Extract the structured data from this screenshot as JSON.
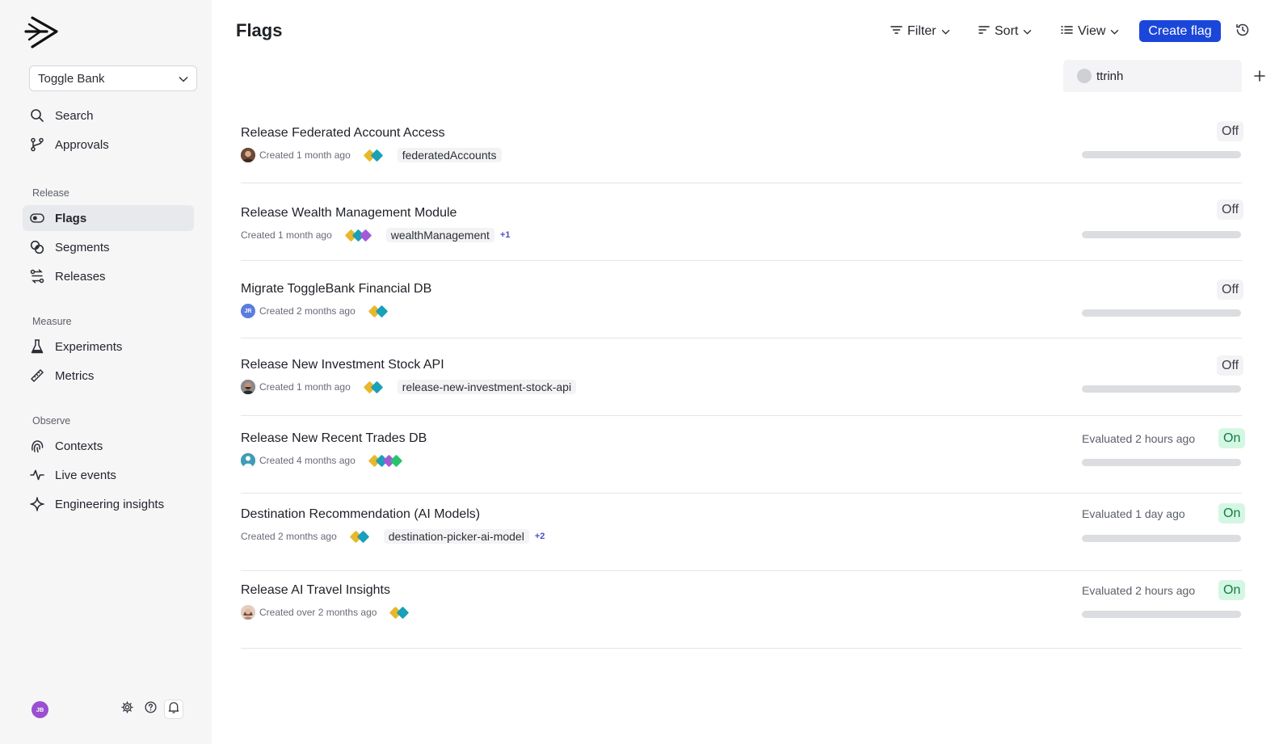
{
  "sidebar": {
    "project": "Toggle Bank",
    "top_items": [
      {
        "label": "Search",
        "icon": "search-icon"
      },
      {
        "label": "Approvals",
        "icon": "branch-icon"
      }
    ],
    "sections": [
      {
        "label": "Release",
        "items": [
          {
            "label": "Flags",
            "icon": "toggle-icon",
            "active": true
          },
          {
            "label": "Segments",
            "icon": "segments-icon"
          },
          {
            "label": "Releases",
            "icon": "releases-icon"
          }
        ]
      },
      {
        "label": "Measure",
        "items": [
          {
            "label": "Experiments",
            "icon": "flask-icon"
          },
          {
            "label": "Metrics",
            "icon": "ruler-icon"
          }
        ]
      },
      {
        "label": "Observe",
        "items": [
          {
            "label": "Contexts",
            "icon": "fingerprint-icon"
          },
          {
            "label": "Live events",
            "icon": "pulse-icon"
          },
          {
            "label": "Engineering insights",
            "icon": "sparkle-icon"
          }
        ]
      }
    ],
    "user_initials": "JB"
  },
  "header": {
    "title": "Flags",
    "filter_label": "Filter",
    "sort_label": "Sort",
    "view_label": "View",
    "create_label": "Create flag"
  },
  "environment": {
    "name": "ttrinh"
  },
  "flags": [
    {
      "name": "Release Federated Account Access",
      "created": "Created 1 month ago",
      "key": "federatedAccounts",
      "key_more": "",
      "evaluated": "",
      "status": "Off"
    },
    {
      "name": "Release Wealth Management Module",
      "created": "Created 1 month ago",
      "key": "wealthManagement",
      "key_more": "+1",
      "evaluated": "",
      "status": "Off"
    },
    {
      "name": "Migrate ToggleBank Financial DB",
      "created": "Created 2 months ago",
      "key": "",
      "key_more": "",
      "evaluated": "",
      "status": "Off",
      "avatar_initials": "JR"
    },
    {
      "name": "Release New Investment Stock API",
      "created": "Created 1 month ago",
      "key": "release-new-investment-stock-api",
      "key_more": "",
      "evaluated": "",
      "status": "Off"
    },
    {
      "name": "Release New Recent Trades DB",
      "created": "Created 4 months ago",
      "key": "",
      "key_more": "",
      "evaluated": "Evaluated 2 hours ago",
      "status": "On"
    },
    {
      "name": "Destination Recommendation (AI Models)",
      "created": "Created 2 months ago",
      "key": "destination-picker-ai-model",
      "key_more": "+2",
      "evaluated": "Evaluated 1 day ago",
      "status": "On"
    },
    {
      "name": "Release AI Travel Insights",
      "created": "Created over 2 months ago",
      "key": "",
      "key_more": "",
      "evaluated": "Evaluated 2 hours ago",
      "status": "On"
    }
  ],
  "colors": {
    "accent": "#1a46d9",
    "on_bg": "#d4f7e4",
    "on_text": "#137a45",
    "diamond_yellow": "#e8b82b",
    "diamond_teal": "#1aa0b8",
    "diamond_purple": "#a45ad8",
    "diamond_green": "#27c46d"
  }
}
